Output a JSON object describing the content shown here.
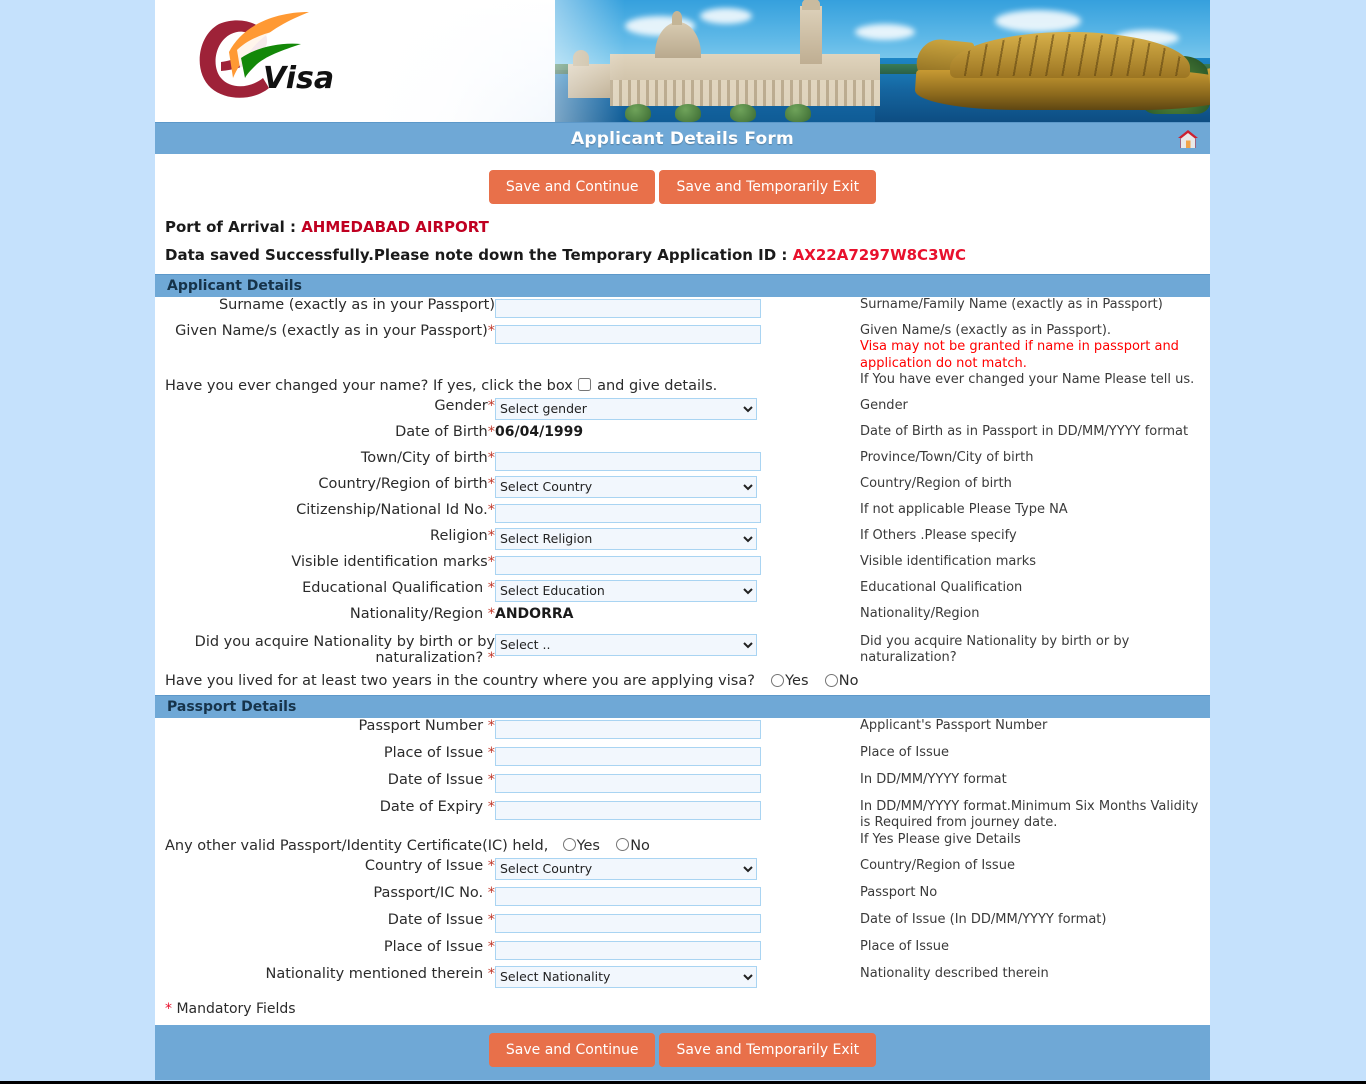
{
  "header": {
    "logo_alt": "eVisa",
    "logo_text_e": "e",
    "logo_text_visa": "Visa",
    "title": "Applicant Details Form",
    "home_icon": "home-icon"
  },
  "toolbar": {
    "save_continue": "Save and Continue",
    "save_exit": "Save and Temporarily Exit"
  },
  "notices": {
    "port_label": "Port of Arrival :",
    "port_value": "AHMEDABAD AIRPORT",
    "saved_label": "Data saved Successfully.Please note down the Temporary Application ID :",
    "saved_value": "AX22A7297W8C3WC"
  },
  "sections": {
    "applicant": "Applicant Details",
    "passport": "Passport Details"
  },
  "applicant": {
    "surname_label": "Surname (exactly as in your Passport)",
    "surname_value": "",
    "surname_help": "Surname/Family Name (exactly as in Passport)",
    "given_label": "Given Name/s (exactly as in your Passport)",
    "given_value": "",
    "given_help_1": "Given Name/s (exactly as in Passport).",
    "given_help_2": "Visa may not be granted if name in passport and application do not match.",
    "changed_name_text_a": "Have you ever changed your name? If yes, click the box",
    "changed_name_text_b": "and give details.",
    "changed_name_help": "If You have ever changed your Name Please tell us.",
    "gender_label": "Gender",
    "gender_value": "Select gender",
    "gender_help": "Gender",
    "dob_label": "Date of Birth",
    "dob_value": "06/04/1999",
    "dob_help": "Date of Birth as in Passport in DD/MM/YYYY format",
    "town_label": "Town/City of birth",
    "town_value": "",
    "town_help": "Province/Town/City of birth",
    "country_birth_label": "Country/Region of birth",
    "country_birth_value": "Select Country",
    "country_birth_help": "Country/Region of birth",
    "citizenship_label": "Citizenship/National Id No.",
    "citizenship_value": "",
    "citizenship_help": "If not applicable Please Type NA",
    "religion_label": "Religion",
    "religion_value": "Select Religion",
    "religion_help": "If Others .Please specify",
    "marks_label": "Visible identification marks",
    "marks_value": "",
    "marks_help": "Visible identification marks",
    "education_label": "Educational Qualification ",
    "education_value": "Select Education",
    "education_help": "Educational Qualification",
    "nationality_label": "Nationality/Region ",
    "nationality_value": "ANDORRA",
    "nationality_help": "Nationality/Region",
    "acquire_label": "Did you acquire Nationality by birth or by naturalization? ",
    "acquire_value": "Select ..",
    "acquire_help": "Did you acquire Nationality by birth or by naturalization?",
    "lived_text": "Have you lived for at least two years in the country where you are applying visa?",
    "lived_yes": "Yes",
    "lived_no": "No"
  },
  "passport": {
    "number_label": "Passport Number ",
    "number_value": "",
    "number_help": "Applicant's Passport Number",
    "place_label": "Place of Issue ",
    "place_value": "",
    "place_help": "Place of Issue",
    "date_issue_label": "Date of Issue ",
    "date_issue_value": "",
    "date_issue_help": "In DD/MM/YYYY format",
    "date_expiry_label": "Date of Expiry ",
    "date_expiry_value": "",
    "date_expiry_help": "In DD/MM/YYYY format.Minimum Six Months Validity is Required from journey date.",
    "other_text": "Any other valid Passport/Identity Certificate(IC) held,",
    "other_yes": "Yes",
    "other_no": "No",
    "other_help": "If Yes Please give Details",
    "country_issue_label": "Country of Issue ",
    "country_issue_value": "Select Country",
    "country_issue_help": "Country/Region of Issue",
    "ic_no_label": "Passport/IC No. ",
    "ic_no_value": "",
    "ic_no_help": "Passport No",
    "ic_date_label": "Date of Issue ",
    "ic_date_value": "",
    "ic_date_help": "Date of Issue (In DD/MM/YYYY format)",
    "ic_place_label": "Place of Issue ",
    "ic_place_value": "",
    "ic_place_help": "Place of Issue",
    "ic_nationality_label": "Nationality mentioned therein ",
    "ic_nationality_value": "Select Nationality",
    "ic_nationality_help": "Nationality described therein"
  },
  "footer": {
    "mandatory": "Mandatory Fields",
    "mandatory_star": "*",
    "save_continue": "Save and Continue",
    "save_exit": "Save and Temporarily Exit"
  },
  "colors": {
    "page_bg": "#c5e1fc",
    "bar_blue": "#6fa8d6",
    "button_orange": "#e8704a",
    "required_red": "#c0392b",
    "alert_red": "#e8112d",
    "field_bg": "#f2f7fd",
    "field_border": "#a9d4f2"
  }
}
